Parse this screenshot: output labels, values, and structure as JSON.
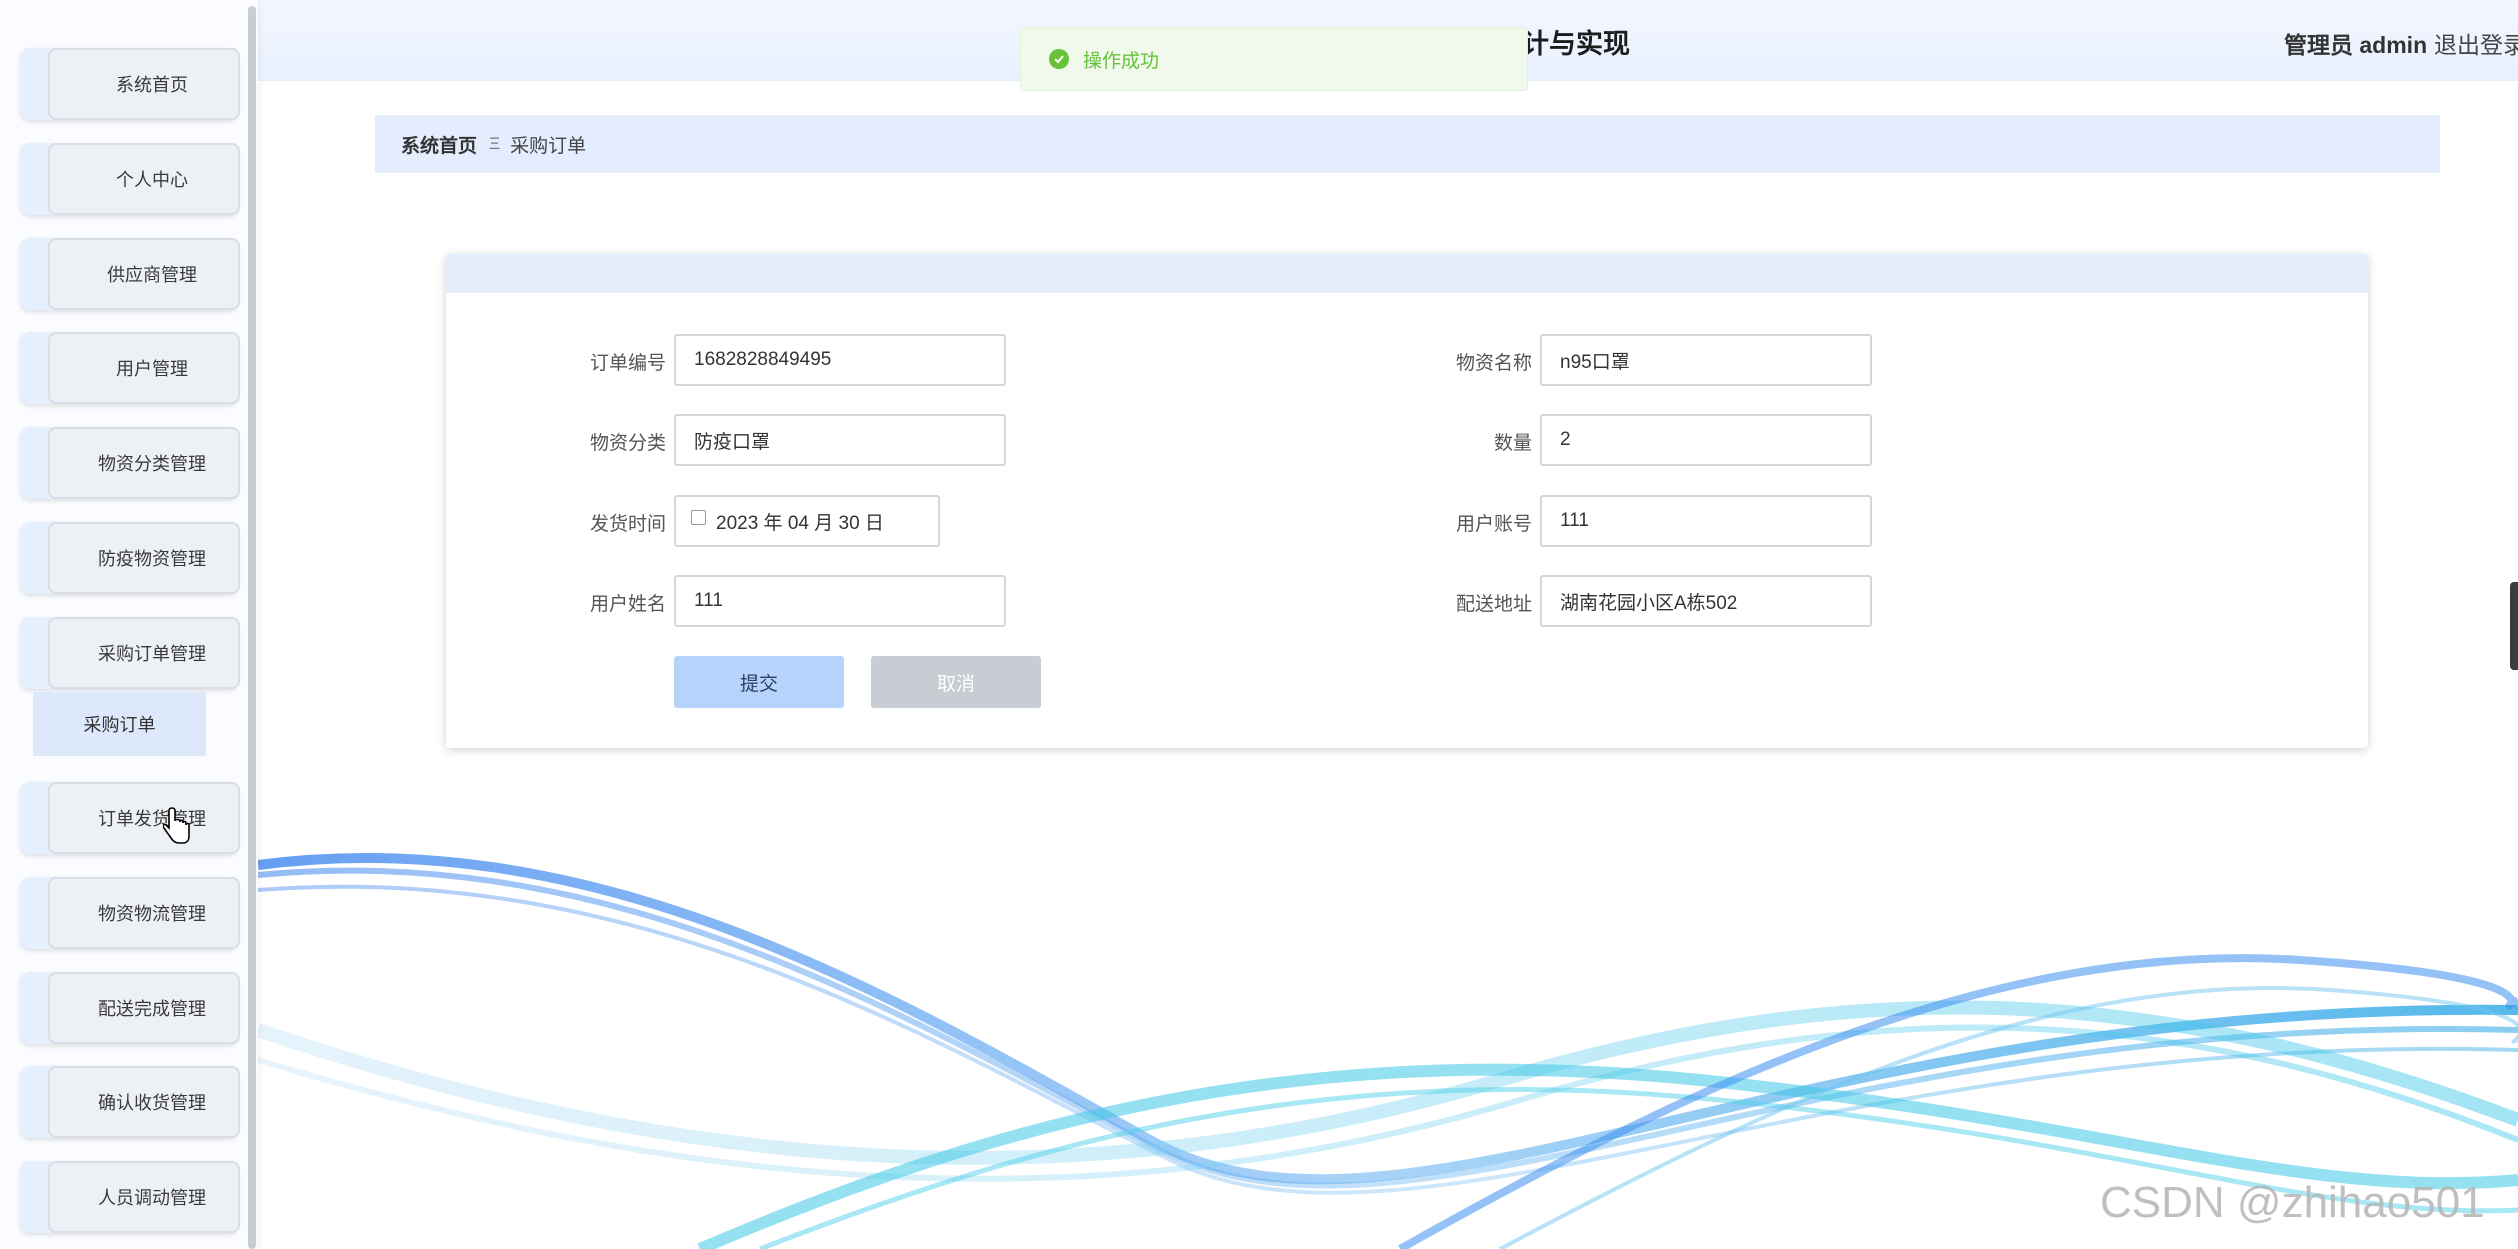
{
  "header": {
    "title": "计与实现",
    "user": "管理员 admin",
    "logout": "退出登录"
  },
  "toast": {
    "text": "操作成功",
    "icon": "check-circle-icon",
    "color": "#67c23a"
  },
  "sidebar": {
    "items": [
      {
        "label": "系统首页"
      },
      {
        "label": "个人中心"
      },
      {
        "label": "供应商管理"
      },
      {
        "label": "用户管理"
      },
      {
        "label": "物资分类管理"
      },
      {
        "label": "防疫物资管理"
      },
      {
        "label": "采购订单管理"
      },
      {
        "label": "订单发货管理"
      },
      {
        "label": "物资物流管理"
      },
      {
        "label": "配送完成管理"
      },
      {
        "label": "确认收货管理"
      },
      {
        "label": "人员调动管理"
      }
    ],
    "sub_item": "采购订单"
  },
  "breadcrumb": {
    "home": "系统首页",
    "separator": "Ξ",
    "current": "采购订单"
  },
  "form": {
    "order_no": {
      "label": "订单编号",
      "value": "1682828849495"
    },
    "material_name": {
      "label": "物资名称",
      "value": "n95口罩"
    },
    "material_category": {
      "label": "物资分类",
      "value": "防疫口罩"
    },
    "quantity": {
      "label": "数量",
      "value": "2"
    },
    "ship_time": {
      "label": "发货时间",
      "value": "2023 年 04 月 30 日"
    },
    "user_account": {
      "label": "用户账号",
      "value": "111"
    },
    "user_name": {
      "label": "用户姓名",
      "value": "111"
    },
    "address": {
      "label": "配送地址",
      "value": "湖南花园小区A栋502"
    },
    "submit_label": "提交",
    "cancel_label": "取消"
  },
  "watermark": "CSDN @zhihao501",
  "colors": {
    "accent": "#e3edfd",
    "submit": "#b6d3fb",
    "cancel": "#c8ccd3",
    "success": "#67c23a"
  }
}
